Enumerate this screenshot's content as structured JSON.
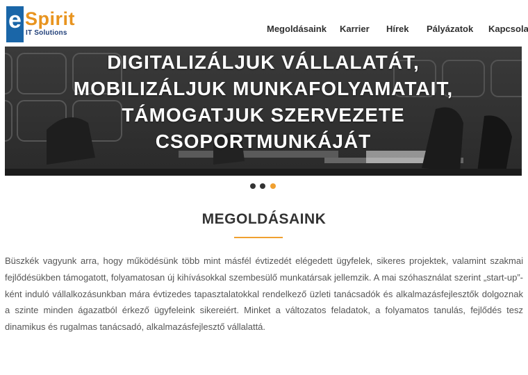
{
  "logo": {
    "letter": "e",
    "word": "Spirit",
    "subtitle": "IT Solutions"
  },
  "nav": {
    "items": [
      {
        "label": "Megoldásaink"
      },
      {
        "label": "Karrier"
      },
      {
        "label": "Hírek"
      },
      {
        "label": "Pályázatok"
      },
      {
        "label": "Kapcsolat"
      }
    ]
  },
  "hero": {
    "lines": [
      "DIGITALIZÁLJUK VÁLLALATÁT,",
      "MOBILIZÁLJUK MUNKAFOLYAMATAIT,",
      "TÁMOGATJUK SZERVEZETE",
      "CSOPORTMUNKÁJÁT"
    ],
    "active_slide": 3,
    "slide_count": 3
  },
  "section": {
    "heading": "MEGOLDÁSAINK",
    "paragraph": "Büszkék vagyunk arra, hogy működésünk több mint másfél évtizedét elégedett ügyfelek, sikeres projektek, valamint szakmai fejlődésükben támogatott, folyamatosan új kihívásokkal szembesülő munkatársak jellemzik. A mai szóhasználat szerint „start-up”-ként induló vállalkozásunkban mára évtizedes tapasztalatokkal rendelkező üzleti tanácsadók és alkalmazásfejlesztők dolgoznak a szinte minden ágazatból érkező ügyfeleink sikereiért. Minket a változatos feladatok, a folyamatos tanulás, fejlődés tesz dinamikus és rugalmas tanácsadó, alkalmazásfejlesztő vállalattá."
  },
  "colors": {
    "accent": "#f0a030",
    "logo_blue": "#1a66a8",
    "logo_orange": "#e8941f",
    "dot_inactive": "#333333"
  }
}
